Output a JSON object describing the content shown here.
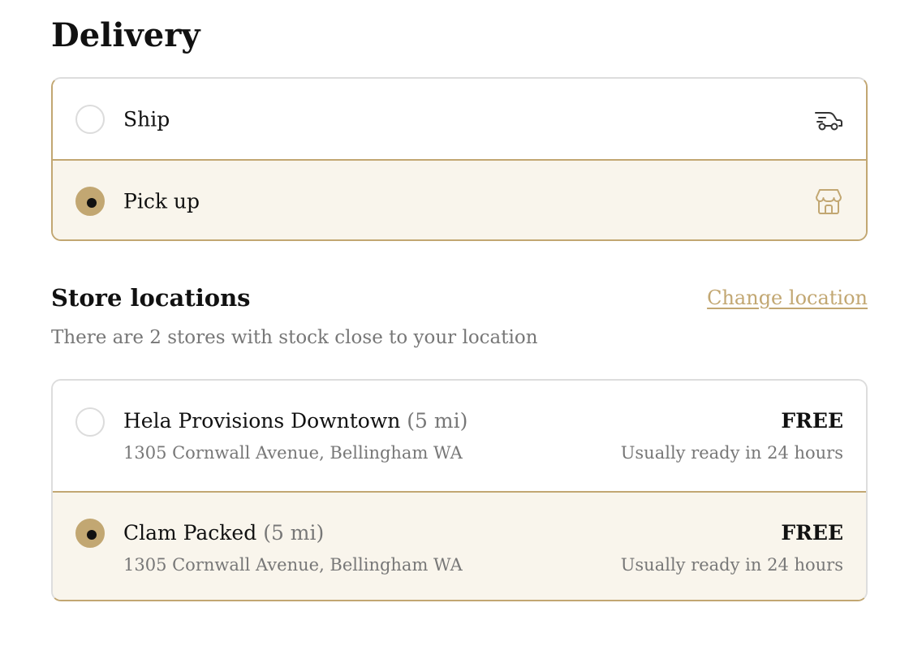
{
  "delivery": {
    "title": "Delivery",
    "options": [
      {
        "label": "Ship",
        "icon": "truck-icon",
        "selected": false
      },
      {
        "label": "Pick up",
        "icon": "store-icon",
        "selected": true
      }
    ]
  },
  "store_locations": {
    "title": "Store locations",
    "change_link": "Change location",
    "subtitle": "There are 2 stores with stock close to your location",
    "stores": [
      {
        "name": "Hela Provisions Downtown",
        "distance": "(5 mi)",
        "address": "1305 Cornwall Avenue, Bellingham WA",
        "price": "FREE",
        "ready": "Usually ready in 24 hours",
        "selected": false
      },
      {
        "name": "Clam Packed",
        "distance": "(5 mi)",
        "address": "1305 Cornwall Avenue, Bellingham WA",
        "price": "FREE",
        "ready": "Usually ready in 24 hours",
        "selected": true
      }
    ]
  },
  "colors": {
    "accent": "#c2a772",
    "selected_bg": "#f9f5ec",
    "border": "#dddddd",
    "muted_text": "#777777"
  }
}
